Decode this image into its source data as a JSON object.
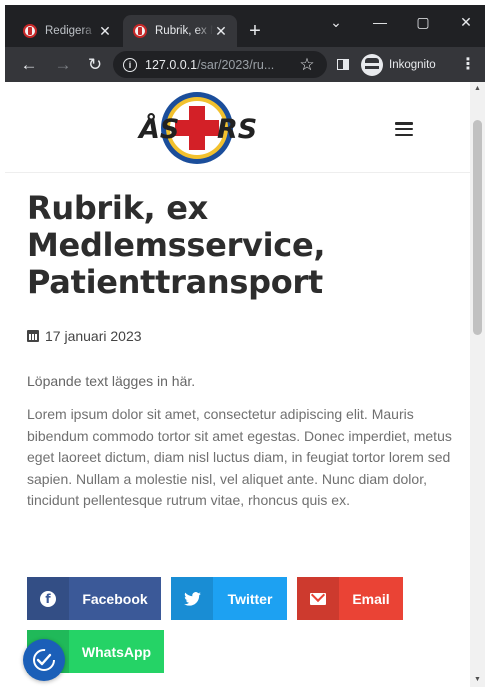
{
  "browser": {
    "tabs": [
      {
        "title": "Redigera",
        "active": false
      },
      {
        "title": "Rubrik, ex Medlemsservice",
        "active": true
      }
    ],
    "new_tab_label": "+",
    "url_host": "127.0.0.1",
    "url_path": "/sar/2023/ru...",
    "profile_label": "Inkognito",
    "window_controls": [
      "chevron-down-icon",
      "minimize-icon",
      "maximize-icon",
      "close-icon"
    ]
  },
  "site": {
    "logo_text_left": "ÅS",
    "logo_text_right": "RS",
    "colors": {
      "brand_red": "#d32027",
      "brand_blue": "#1b4e9b",
      "brand_yellow": "#f2c12e"
    }
  },
  "article": {
    "title": "Rubrik, ex Medlemsservice, Patienttransport",
    "date": "17 januari 2023",
    "lead": "Löpande text lägges in här.",
    "body": "Lorem ipsum dolor sit amet, consectetur adipiscing elit. Mauris bibendum commodo tortor sit amet egestas. Donec imperdiet, metus eget laoreet dictum, diam nisl luctus diam, in feugiat tortor lorem sed sapien. Nullam a molestie nisl, vel aliquet ante. Nunc diam dolor, tincidunt pellentesque rutrum vitae, rhoncus quis ex."
  },
  "share": {
    "facebook": "Facebook",
    "twitter": "Twitter",
    "email": "Email",
    "whatsapp": "WhatsApp",
    "colors": {
      "facebook": "#3b5998",
      "twitter": "#1da1f2",
      "email": "#ea4335",
      "whatsapp": "#25d366"
    }
  }
}
